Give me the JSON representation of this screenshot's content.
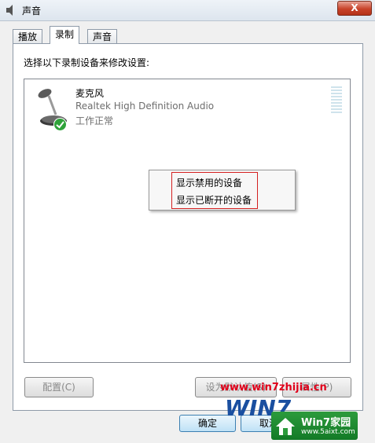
{
  "window": {
    "title": "声音",
    "close_label": "X"
  },
  "tabs": [
    {
      "label": "播放"
    },
    {
      "label": "录制"
    },
    {
      "label": "声音"
    }
  ],
  "instruction": "选择以下录制设备来修改设置:",
  "device": {
    "name": "麦克风",
    "description": "Realtek High Definition Audio",
    "status": "工作正常",
    "icon": "microphone-icon",
    "status_icon": "checkmark-icon"
  },
  "context_menu": {
    "items": [
      "显示禁用的设备",
      "显示已断开的设备"
    ]
  },
  "buttons": {
    "configure": "配置(C)",
    "set_default": "设为默认值(S)",
    "properties": "属性(P)",
    "ok": "确定",
    "cancel": "取消"
  },
  "watermark": {
    "url": "www.win7zhijia.cn",
    "logo": "WIN7",
    "badge_title": "Win7家园",
    "badge_url": "www.5aixt.com"
  },
  "colors": {
    "accent": "#3c7fb1",
    "highlight_box": "#d42020",
    "watermark_red": "#e0001a"
  }
}
